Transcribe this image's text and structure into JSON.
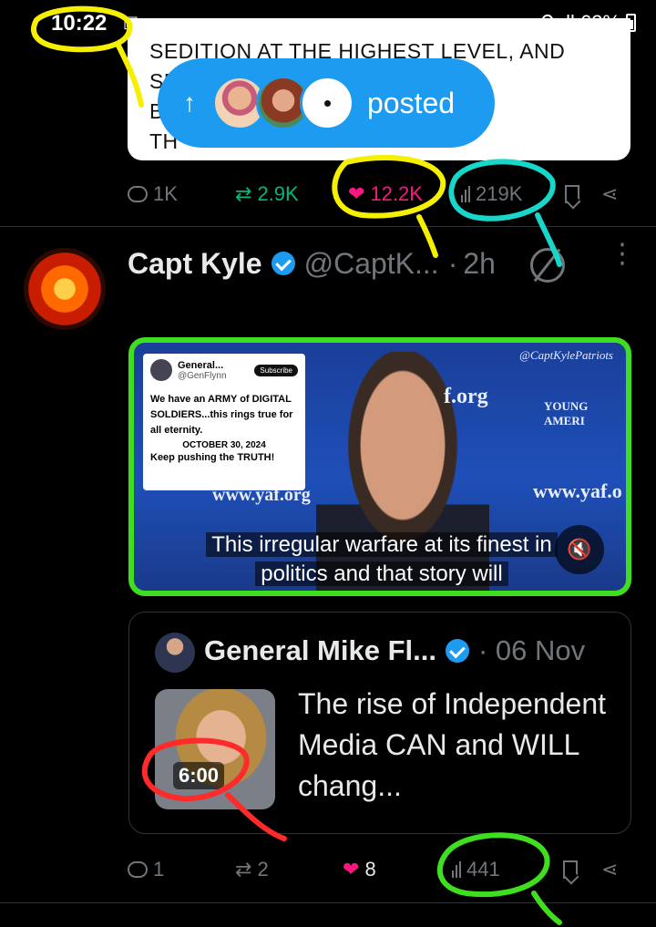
{
  "status_bar": {
    "time": "10:22",
    "left_icons": "▣ ꝏ",
    "signal_icons": "⚲ ıll",
    "battery": "62%"
  },
  "quoted_card": {
    "text": "SEDITION AT THE HIGHEST LEVEL, AND\nSE                              HERE CAN\nB                                OF WHAT\nTH"
  },
  "posted_toast": {
    "arrow": "↑",
    "label": "posted"
  },
  "top_actions": {
    "replies": "1K",
    "reposts": "2.9K",
    "likes": "12.2K",
    "views": "219K"
  },
  "tweet": {
    "name": "Capt Kyle",
    "handle": "@CaptK...",
    "dot": "·",
    "time": "2h",
    "more": "⋮",
    "media": {
      "watermark": "@CaptKylePatriots",
      "card_name": "General...",
      "card_handle": "@GenFlynn",
      "card_subscribe": "Subscribe",
      "card_body": "We have an ARMY of DIGITAL SOLDIERS...this rings true for all eternity.",
      "card_date": "OCTOBER 30, 2024",
      "card_truth": "Keep pushing the TRUTH!",
      "bg_text_1": "f.org",
      "bg_text_2": "www.yaf.org",
      "bg_text_3": "www.yaf.o",
      "bg_text_4": "YOUNG AMERI",
      "caption_line1": "This irregular warfare at its finest in",
      "caption_line2": "politics and that story will",
      "mute": "🔇"
    },
    "quote": {
      "name": "General Mike Fl...",
      "date": "· 06 Nov",
      "duration": "6:00",
      "text": "The rise of Independent Media CAN and WILL chang..."
    },
    "actions": {
      "replies": "1",
      "reposts": "2",
      "likes": "8",
      "views": "441"
    }
  },
  "colors": {
    "background": "#000000",
    "accent_blue": "#1d9bf0",
    "like_pink": "#f91880",
    "repost_green": "#00ba7c",
    "muted": "#71767b",
    "annotation_yellow": "#f5f000",
    "annotation_cyan": "#18d6c9",
    "annotation_green": "#3fde1f",
    "annotation_red": "#ff2a2a"
  }
}
